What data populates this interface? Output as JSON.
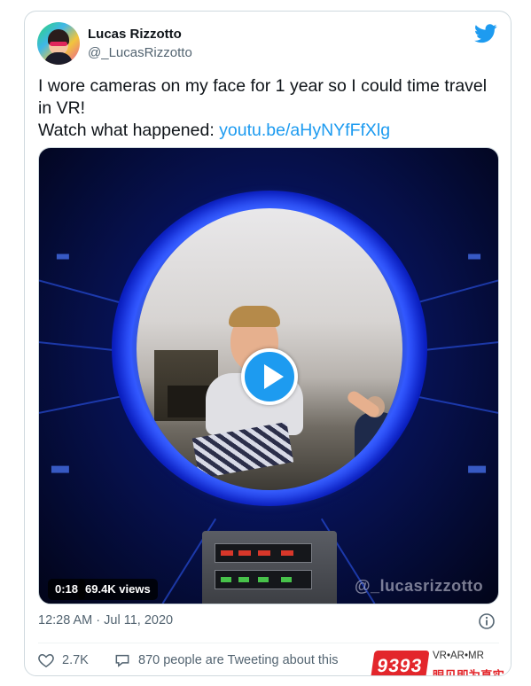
{
  "author": {
    "name": "Lucas Rizzotto",
    "handle": "@_LucasRizzotto"
  },
  "tweet": {
    "line1": "I wore cameras on my face for 1 year so I could time travel in VR!",
    "line2_prefix": "Watch what happened: ",
    "link_text": "youtu.be/aHyNYfFfXlg"
  },
  "media": {
    "duration": "0:18",
    "views": "69.4K views",
    "watermark": "@_lucasrizzotto"
  },
  "meta": {
    "timestamp": "12:28 AM · Jul 11, 2020"
  },
  "actions": {
    "likes": "2.7K",
    "tweeting_text": "870 people are Tweeting about this"
  },
  "overlay_badge": {
    "mark": "9393",
    "top_text": "VR•AR•MR",
    "bottom_text": "眼见即为真实"
  },
  "colors": {
    "twitter_blue": "#1d9bf0",
    "text_primary": "#0f1419",
    "text_secondary": "#536471",
    "badge_red": "#e3262b"
  },
  "icons": {
    "brand": "twitter-bird-icon",
    "info": "info-icon",
    "like": "heart-icon",
    "reply": "speech-bubble-icon",
    "play": "play-icon"
  }
}
